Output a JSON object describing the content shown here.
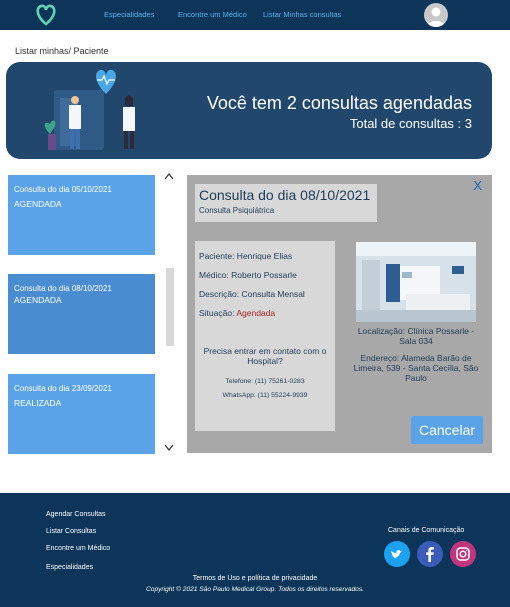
{
  "nav": {
    "links": [
      "Especialidades",
      "Encontre um Médico",
      "Listar Minhas consultas"
    ]
  },
  "breadcrumb": "Listar minhas/ Paciente",
  "banner": {
    "title": "Você tem 2 consultas agendadas",
    "subtitle": "Total de consultas : 3"
  },
  "list": [
    {
      "title": "Consulta do dia 05/10/2021",
      "status": "AGENDADA"
    },
    {
      "title": "Consulta do dia 08/10/2021",
      "status": "AGENDADA"
    },
    {
      "title": "Consulta do dia 23/09/2021",
      "status": "REALIZADA"
    }
  ],
  "detail": {
    "close": "X",
    "title": "Consulta do dia 08/10/2021",
    "type": "Consulta Psiquiátrica",
    "patient": "Paciente: Henrique Elias",
    "doctor": "Médico: Roberto Possarle",
    "description": "Descrição: Consulta Mensal",
    "situation_label": "Situação: ",
    "situation_value": "Agendada",
    "contact_q": "Precisa entrar em contato com o Hospital?",
    "phone": "Telefone: (11) 75261-0283",
    "whatsapp": "WhatsApp: (11) 55224-9939",
    "location": "Localização: Clínica Possarle - Sala 034",
    "address": "Endereço: Alameda Barão de Limeira, 539 - Santa Cecília, São Paulo",
    "cancel": "Cancelar"
  },
  "footer": {
    "links": [
      "Agendar Consultas",
      "Listar Consultas",
      "Encontre um Médico",
      "Especialidades"
    ],
    "channels": "Canais de Comunicação",
    "terms": "Termos de Uso e política de privacidade",
    "copyright": "Copyright © 2021 São Paulo Medical Group. Todos os direitos reservados."
  },
  "colors": {
    "navbar": "#0d3559",
    "banner": "#22476d",
    "card": "#5aa3e8",
    "situation": "#a52727"
  },
  "icons": [
    "logo-icon",
    "user-avatar-icon",
    "twitter-icon",
    "facebook-icon",
    "instagram-icon",
    "scroll-up-icon",
    "scroll-down-icon"
  ]
}
